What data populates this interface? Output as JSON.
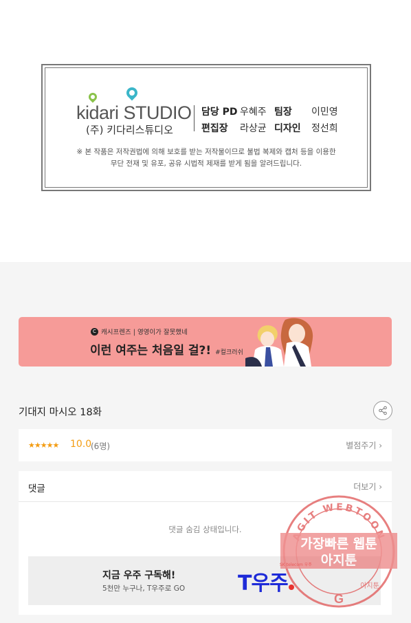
{
  "credits": {
    "logo_word": "kidari STUDIO",
    "logo_sub": "(주) 키다리스튜디오",
    "staff": [
      {
        "role": "담당 PD",
        "name": "우혜주"
      },
      {
        "role": "팀장",
        "name": "이민영"
      },
      {
        "role": "편집장",
        "name": "라상균"
      },
      {
        "role": "디자인",
        "name": "정선희"
      }
    ],
    "copyright_line1": "※ 본 작품은 저작권법에 의해 보호를 받는 저작물이므로 불법 복제와 캡처 등을 이용한",
    "copyright_line2": "무단 전재 및 유포, 공유 시법적 제재를 받게 됨을 알려드립니다."
  },
  "banner": {
    "brand": "캐시프렌즈 | 영영이가 잘못했네",
    "brand_mark": "C",
    "title": "이런 여주는 처음일 걸?!",
    "tag": "#컬크러쉬"
  },
  "episode": {
    "title": "기대지 마시오 18화"
  },
  "rating": {
    "stars": "★★★★★",
    "score": "10.0",
    "count": "(6명)",
    "rate_label": "별점주기 ›"
  },
  "comments": {
    "title": "댓글",
    "more_label": "더보기 ›",
    "hidden_message": "댓글 숨김 상태입니다."
  },
  "ad": {
    "title": "지금 우주 구독해!",
    "subtitle": "5천만 누구나, T우주로 GO",
    "logo": "T우주",
    "skt": "SK telecom 우주"
  },
  "watermark": {
    "ring_text": "AGIT WEBTOON",
    "line1": "가장빠른 웹툰",
    "line2": "아지툰",
    "bottom": "아지툰"
  },
  "colors": {
    "banner_bg": "#f69b98",
    "rating_accent": "#f39c12",
    "ad_logo": "#1e2bd8",
    "stamp": "#e05555"
  }
}
